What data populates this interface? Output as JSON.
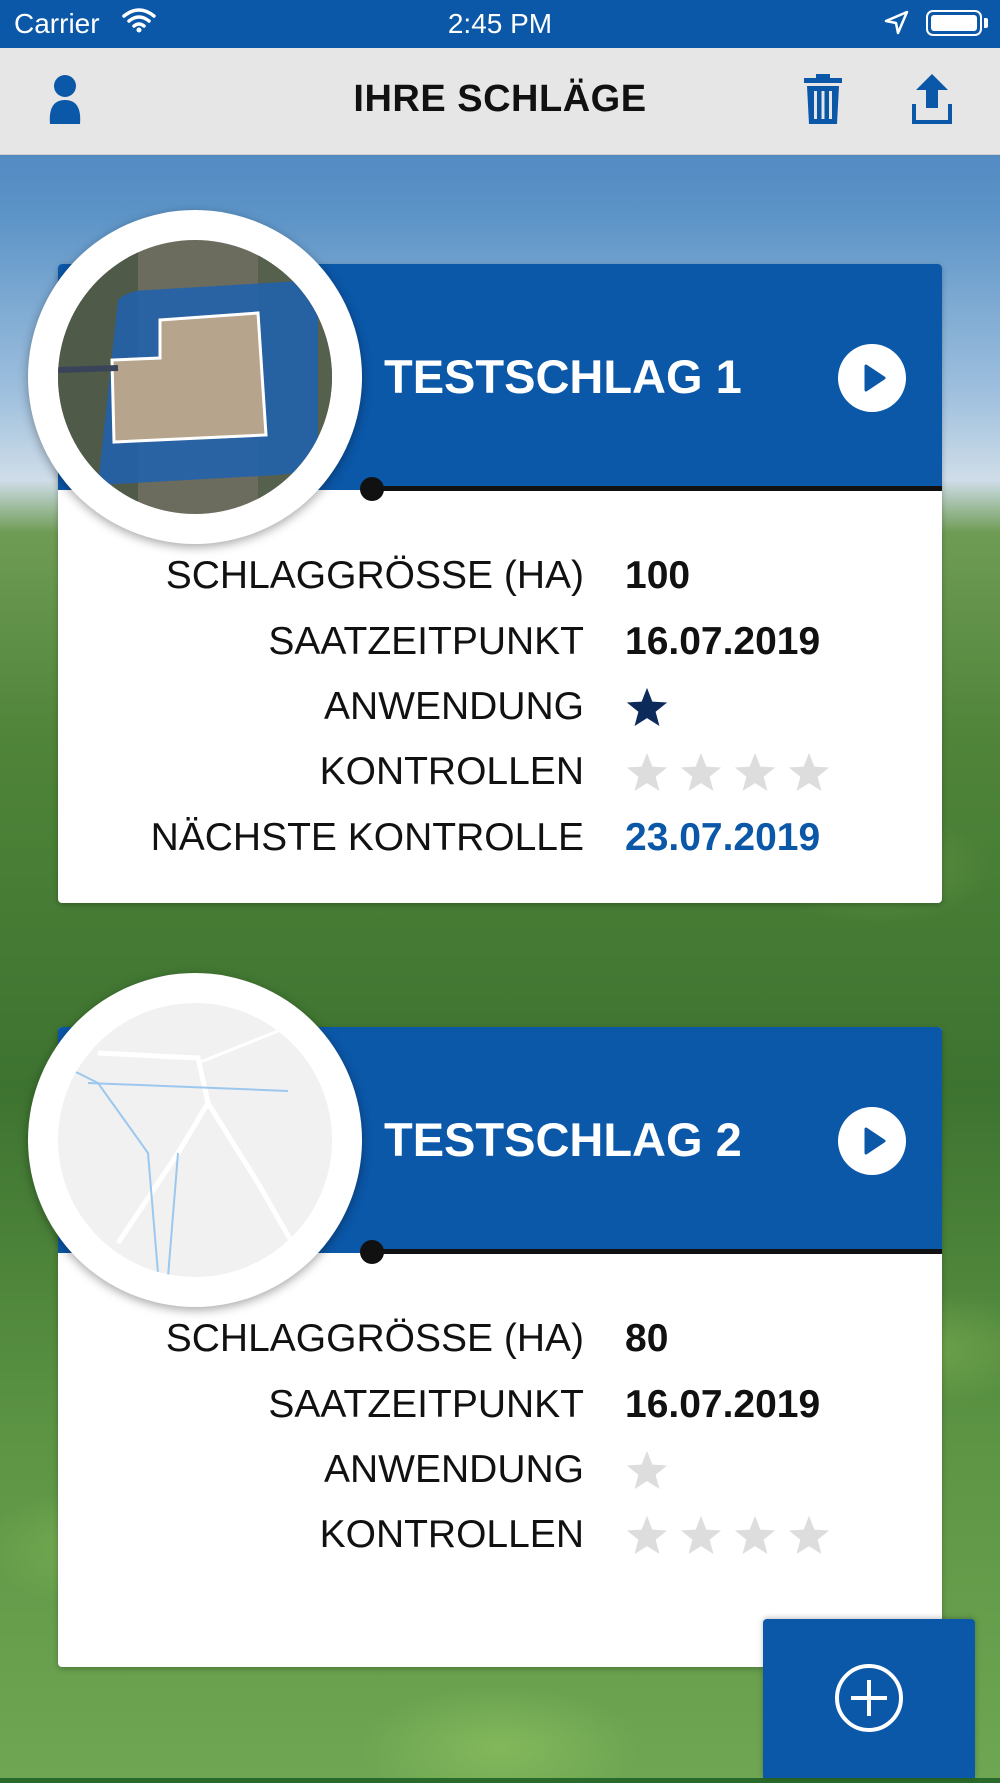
{
  "status_bar": {
    "carrier": "Carrier",
    "time": "2:45 PM"
  },
  "nav": {
    "title": "IHRE SCHLÄGE",
    "icons": [
      "person-icon",
      "trash-icon",
      "upload-icon"
    ]
  },
  "colors": {
    "primary": "#0b57a8",
    "star_filled": "#0d2b5a",
    "star_empty": "#dddddd"
  },
  "fields": [
    {
      "name": "TESTSCHLAG 1",
      "rows": {
        "size_label": "SCHLAGGRÖSSE (HA)",
        "size_value": "100",
        "sowing_label": "SAATZEITPUNKT",
        "sowing_value": "16.07.2019",
        "application_label": "ANWENDUNG",
        "application_stars": {
          "filled": 1,
          "total": 1
        },
        "controls_label": "KONTROLLEN",
        "controls_stars": {
          "filled": 0,
          "total": 4
        },
        "next_control_label": "NÄCHSTE KONTROLLE",
        "next_control_value": "23.07.2019"
      }
    },
    {
      "name": "TESTSCHLAG 2",
      "rows": {
        "size_label": "SCHLAGGRÖSSE (HA)",
        "size_value": "80",
        "sowing_label": "SAATZEITPUNKT",
        "sowing_value": "16.07.2019",
        "application_label": "ANWENDUNG",
        "application_stars": {
          "filled": 0,
          "total": 1
        },
        "controls_label": "KONTROLLEN",
        "controls_stars": {
          "filled": 0,
          "total": 4
        }
      }
    }
  ],
  "fab": {
    "icon": "plus-circle-icon"
  }
}
